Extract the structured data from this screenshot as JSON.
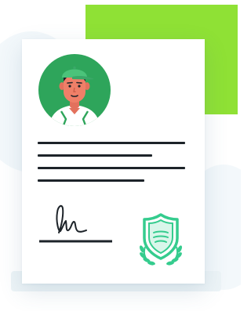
{
  "illustration": {
    "subject": "certificate-document",
    "colors": {
      "accent_green": "#8fe135",
      "avatar_green": "#2ea55b",
      "cap_green": "#4bc37a",
      "seal_mint": "#35cc8e",
      "ink": "#1d2329",
      "paper": "#ffffff"
    },
    "icons": [
      "avatar-icon",
      "signature-icon",
      "seal-badge-icon",
      "laurel-icon"
    ]
  }
}
